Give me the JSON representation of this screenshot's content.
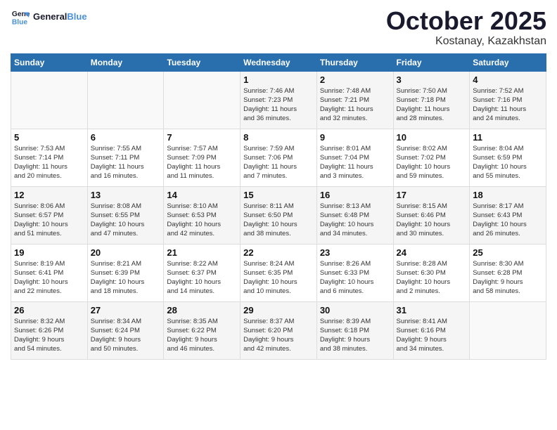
{
  "logo": {
    "text_general": "General",
    "text_blue": "Blue"
  },
  "title": "October 2025",
  "location": "Kostanay, Kazakhstan",
  "days_header": [
    "Sunday",
    "Monday",
    "Tuesday",
    "Wednesday",
    "Thursday",
    "Friday",
    "Saturday"
  ],
  "weeks": [
    [
      {
        "day": "",
        "info": ""
      },
      {
        "day": "",
        "info": ""
      },
      {
        "day": "",
        "info": ""
      },
      {
        "day": "1",
        "info": "Sunrise: 7:46 AM\nSunset: 7:23 PM\nDaylight: 11 hours\nand 36 minutes."
      },
      {
        "day": "2",
        "info": "Sunrise: 7:48 AM\nSunset: 7:21 PM\nDaylight: 11 hours\nand 32 minutes."
      },
      {
        "day": "3",
        "info": "Sunrise: 7:50 AM\nSunset: 7:18 PM\nDaylight: 11 hours\nand 28 minutes."
      },
      {
        "day": "4",
        "info": "Sunrise: 7:52 AM\nSunset: 7:16 PM\nDaylight: 11 hours\nand 24 minutes."
      }
    ],
    [
      {
        "day": "5",
        "info": "Sunrise: 7:53 AM\nSunset: 7:14 PM\nDaylight: 11 hours\nand 20 minutes."
      },
      {
        "day": "6",
        "info": "Sunrise: 7:55 AM\nSunset: 7:11 PM\nDaylight: 11 hours\nand 16 minutes."
      },
      {
        "day": "7",
        "info": "Sunrise: 7:57 AM\nSunset: 7:09 PM\nDaylight: 11 hours\nand 11 minutes."
      },
      {
        "day": "8",
        "info": "Sunrise: 7:59 AM\nSunset: 7:06 PM\nDaylight: 11 hours\nand 7 minutes."
      },
      {
        "day": "9",
        "info": "Sunrise: 8:01 AM\nSunset: 7:04 PM\nDaylight: 11 hours\nand 3 minutes."
      },
      {
        "day": "10",
        "info": "Sunrise: 8:02 AM\nSunset: 7:02 PM\nDaylight: 10 hours\nand 59 minutes."
      },
      {
        "day": "11",
        "info": "Sunrise: 8:04 AM\nSunset: 6:59 PM\nDaylight: 10 hours\nand 55 minutes."
      }
    ],
    [
      {
        "day": "12",
        "info": "Sunrise: 8:06 AM\nSunset: 6:57 PM\nDaylight: 10 hours\nand 51 minutes."
      },
      {
        "day": "13",
        "info": "Sunrise: 8:08 AM\nSunset: 6:55 PM\nDaylight: 10 hours\nand 47 minutes."
      },
      {
        "day": "14",
        "info": "Sunrise: 8:10 AM\nSunset: 6:53 PM\nDaylight: 10 hours\nand 42 minutes."
      },
      {
        "day": "15",
        "info": "Sunrise: 8:11 AM\nSunset: 6:50 PM\nDaylight: 10 hours\nand 38 minutes."
      },
      {
        "day": "16",
        "info": "Sunrise: 8:13 AM\nSunset: 6:48 PM\nDaylight: 10 hours\nand 34 minutes."
      },
      {
        "day": "17",
        "info": "Sunrise: 8:15 AM\nSunset: 6:46 PM\nDaylight: 10 hours\nand 30 minutes."
      },
      {
        "day": "18",
        "info": "Sunrise: 8:17 AM\nSunset: 6:43 PM\nDaylight: 10 hours\nand 26 minutes."
      }
    ],
    [
      {
        "day": "19",
        "info": "Sunrise: 8:19 AM\nSunset: 6:41 PM\nDaylight: 10 hours\nand 22 minutes."
      },
      {
        "day": "20",
        "info": "Sunrise: 8:21 AM\nSunset: 6:39 PM\nDaylight: 10 hours\nand 18 minutes."
      },
      {
        "day": "21",
        "info": "Sunrise: 8:22 AM\nSunset: 6:37 PM\nDaylight: 10 hours\nand 14 minutes."
      },
      {
        "day": "22",
        "info": "Sunrise: 8:24 AM\nSunset: 6:35 PM\nDaylight: 10 hours\nand 10 minutes."
      },
      {
        "day": "23",
        "info": "Sunrise: 8:26 AM\nSunset: 6:33 PM\nDaylight: 10 hours\nand 6 minutes."
      },
      {
        "day": "24",
        "info": "Sunrise: 8:28 AM\nSunset: 6:30 PM\nDaylight: 10 hours\nand 2 minutes."
      },
      {
        "day": "25",
        "info": "Sunrise: 8:30 AM\nSunset: 6:28 PM\nDaylight: 9 hours\nand 58 minutes."
      }
    ],
    [
      {
        "day": "26",
        "info": "Sunrise: 8:32 AM\nSunset: 6:26 PM\nDaylight: 9 hours\nand 54 minutes."
      },
      {
        "day": "27",
        "info": "Sunrise: 8:34 AM\nSunset: 6:24 PM\nDaylight: 9 hours\nand 50 minutes."
      },
      {
        "day": "28",
        "info": "Sunrise: 8:35 AM\nSunset: 6:22 PM\nDaylight: 9 hours\nand 46 minutes."
      },
      {
        "day": "29",
        "info": "Sunrise: 8:37 AM\nSunset: 6:20 PM\nDaylight: 9 hours\nand 42 minutes."
      },
      {
        "day": "30",
        "info": "Sunrise: 8:39 AM\nSunset: 6:18 PM\nDaylight: 9 hours\nand 38 minutes."
      },
      {
        "day": "31",
        "info": "Sunrise: 8:41 AM\nSunset: 6:16 PM\nDaylight: 9 hours\nand 34 minutes."
      },
      {
        "day": "",
        "info": ""
      }
    ]
  ]
}
